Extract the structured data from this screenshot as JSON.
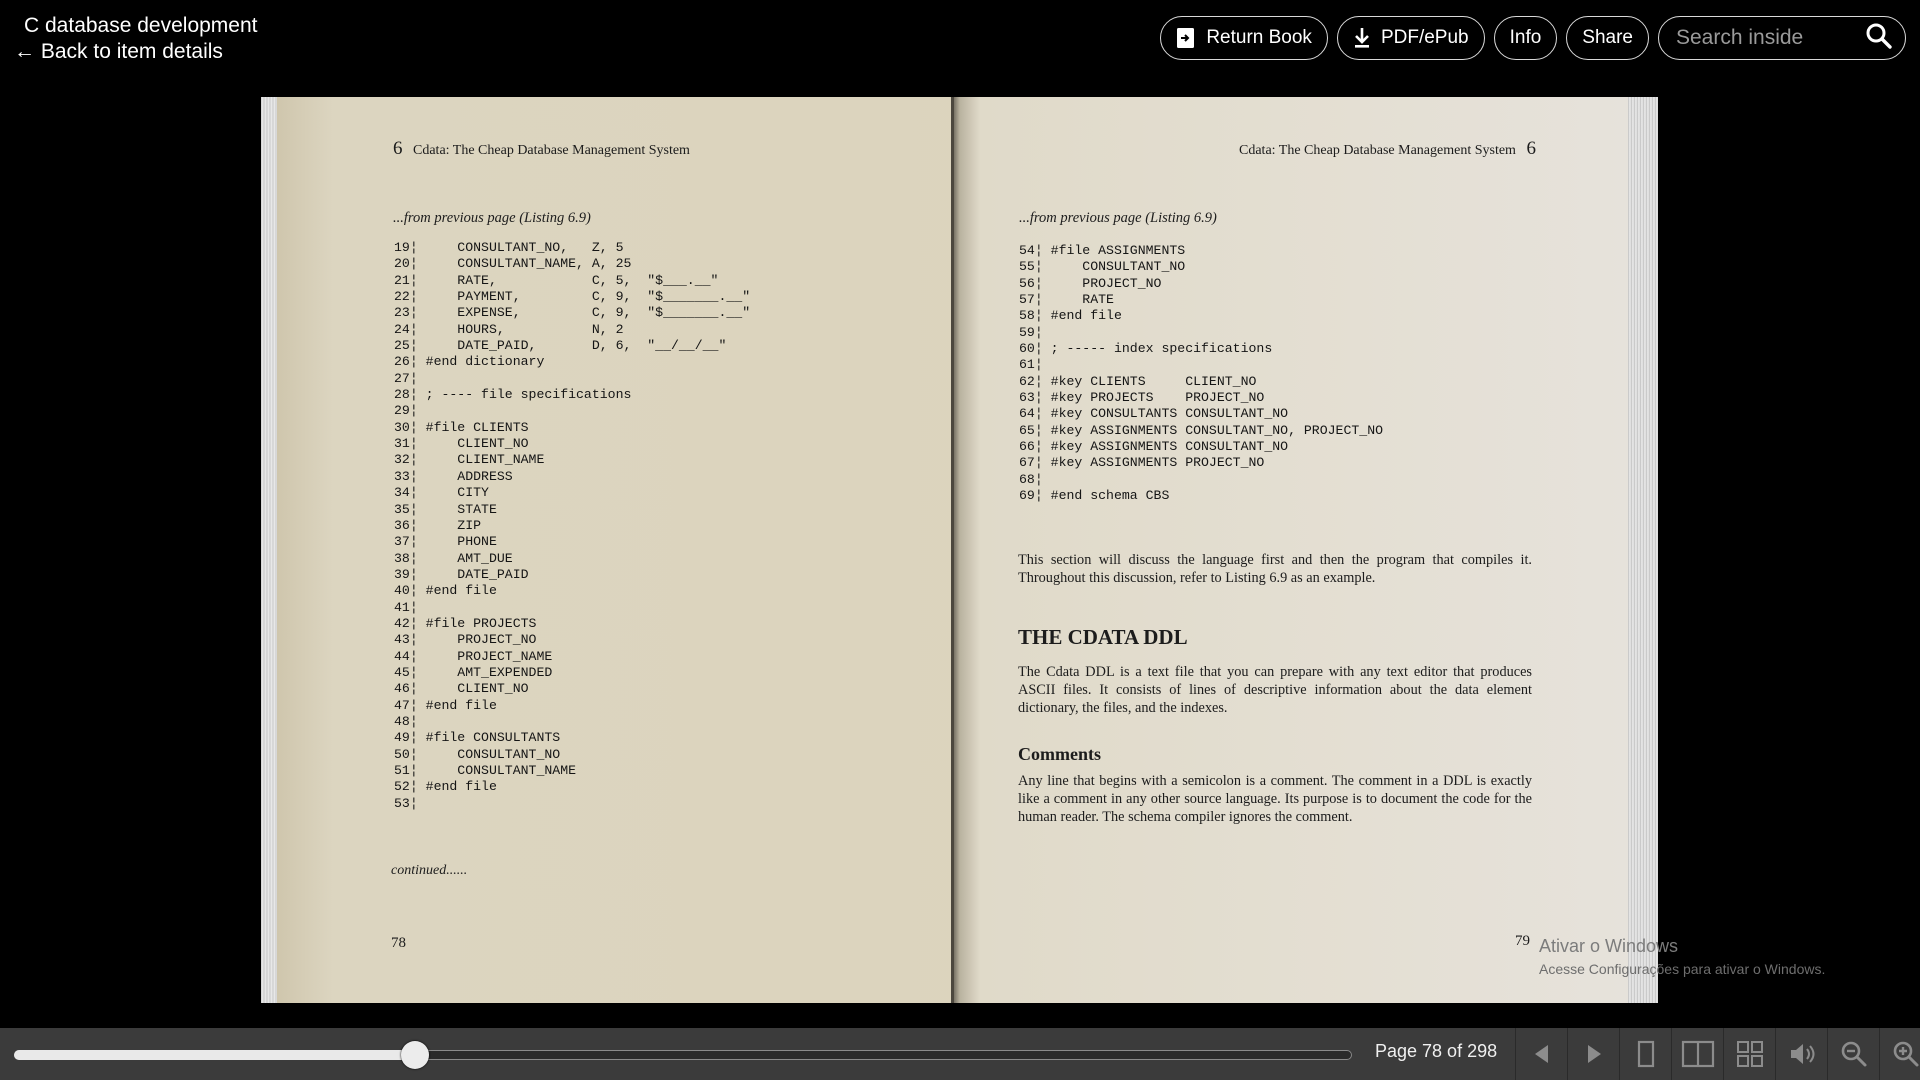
{
  "header": {
    "title": "C database development",
    "back_link": "← Back to item details",
    "buttons": {
      "return_book": "Return Book",
      "pdf_epub": "PDF/ePub",
      "info": "Info",
      "share": "Share"
    },
    "search": {
      "placeholder": "Search inside",
      "value": ""
    }
  },
  "left_page": {
    "chapter_number": "6",
    "running_head": "Cdata: The Cheap Database Management System",
    "from_previous": "...from previous page (Listing 6.9)",
    "code_lines": [
      "19¦     CONSULTANT_NO,   Z, 5",
      "20¦     CONSULTANT_NAME, A, 25",
      "21¦     RATE,            C, 5,  \"$___.__\"",
      "22¦     PAYMENT,         C, 9,  \"$_______.__\"",
      "23¦     EXPENSE,         C, 9,  \"$_______.__\"",
      "24¦     HOURS,           N, 2",
      "25¦     DATE_PAID,       D, 6,  \"__/__/__\"",
      "26¦ #end dictionary",
      "27¦",
      "28¦ ; ---- file specifications",
      "29¦",
      "30¦ #file CLIENTS",
      "31¦     CLIENT_NO",
      "32¦     CLIENT_NAME",
      "33¦     ADDRESS",
      "34¦     CITY",
      "35¦     STATE",
      "36¦     ZIP",
      "37¦     PHONE",
      "38¦     AMT_DUE",
      "39¦     DATE_PAID",
      "40¦ #end file",
      "41¦",
      "42¦ #file PROJECTS",
      "43¦     PROJECT_NO",
      "44¦     PROJECT_NAME",
      "45¦     AMT_EXPENDED",
      "46¦     CLIENT_NO",
      "47¦ #end file",
      "48¦",
      "49¦ #file CONSULTANTS",
      "50¦     CONSULTANT_NO",
      "51¦     CONSULTANT_NAME",
      "52¦ #end file",
      "53¦"
    ],
    "continued": "continued......",
    "page_number": "78"
  },
  "right_page": {
    "chapter_number": "6",
    "running_head": "Cdata: The Cheap Database Management System",
    "from_previous": "...from previous page (Listing 6.9)",
    "code_lines": [
      "54¦ #file ASSIGNMENTS",
      "55¦     CONSULTANT_NO",
      "56¦     PROJECT_NO",
      "57¦     RATE",
      "58¦ #end file",
      "59¦",
      "60¦ ; ----- index specifications",
      "61¦",
      "62¦ #key CLIENTS     CLIENT_NO",
      "63¦ #key PROJECTS    PROJECT_NO",
      "64¦ #key CONSULTANTS CONSULTANT_NO",
      "65¦ #key ASSIGNMENTS CONSULTANT_NO, PROJECT_NO",
      "66¦ #key ASSIGNMENTS CONSULTANT_NO",
      "67¦ #key ASSIGNMENTS PROJECT_NO",
      "68¦",
      "69¦ #end schema CBS"
    ],
    "intro_paragraph": "This section will discuss the language first and then the program that compiles it. Throughout this discussion, refer to Listing 6.9 as an example.",
    "heading": "THE CDATA DDL",
    "ddl_paragraph": "The Cdata DDL is a text file that you can prepare with any text editor that produces ASCII files. It consists of lines of descriptive information about the data element dictionary, the files, and the indexes.",
    "subheading": "Comments",
    "comments_paragraph": "Any line that begins with a semicolon is a comment. The comment in a DDL is exactly like a comment in any other source language. Its purpose is to document the code for the human reader. The schema compiler ignores the comment.",
    "page_number": "79"
  },
  "watermark": {
    "line1": "Ativar o Windows",
    "line2": "Acesse Configurações para ativar o Windows."
  },
  "footer": {
    "page_indicator": "Page 78 of 298",
    "progress_fraction": 0.3
  },
  "icons": {
    "prev": "triangle-left-icon",
    "next": "triangle-right-icon",
    "one_page": "one-page-view-icon",
    "two_page": "two-page-view-icon",
    "thumbnails": "thumbnail-grid-icon",
    "read_aloud": "speaker-icon",
    "zoom_out": "zoom-out-icon",
    "zoom_in": "zoom-in-icon"
  }
}
